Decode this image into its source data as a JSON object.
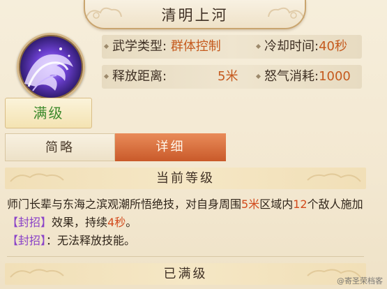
{
  "skill": {
    "title": "清明上河",
    "level_label": "满级"
  },
  "stats": {
    "type_label": "武学类型:",
    "type_value": "群体控制",
    "cooldown_label": "冷却时间:",
    "cooldown_value": "40秒",
    "range_label": "释放距离:",
    "range_value": "5米",
    "rage_label": "怒气消耗:",
    "rage_value": "1000"
  },
  "tabs": {
    "simple": "简略",
    "detail": "详细"
  },
  "sections": {
    "current_level": "当前等级",
    "max_level": "已满级"
  },
  "description": {
    "part1": "师门长辈与东海之滨观潮所悟绝技，对自身周围",
    "range": "5米",
    "part2": "区域内",
    "count": "12",
    "part3": "个敌人施加",
    "effect": "【封招】",
    "part4": "效果，持续",
    "duration": "4秒",
    "part5": "。",
    "effect2": "【封招】",
    "part6": "：无法释放技能。"
  },
  "watermark": "@寄圣荣档客",
  "colors": {
    "accent_orange": "#c55a1e",
    "level_green": "#3d8a2c",
    "effect_purple": "#8a42c8",
    "tab_active": "#c95a2a"
  }
}
